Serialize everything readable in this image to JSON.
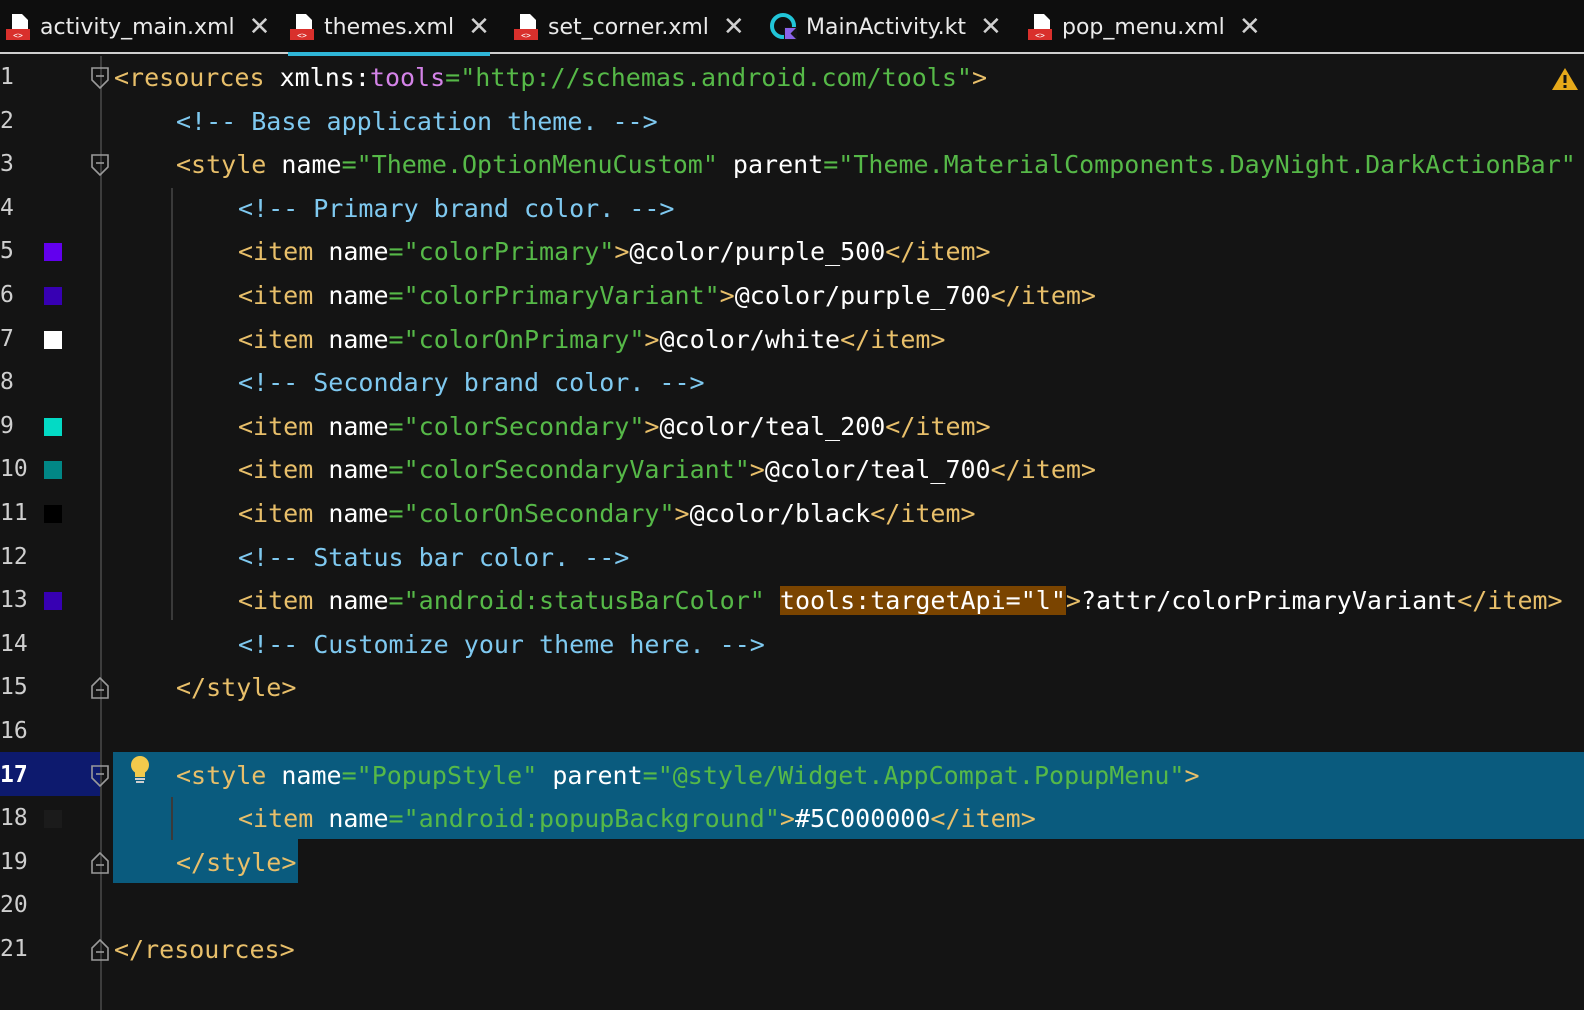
{
  "tabs": [
    {
      "label": "activity_main.xml",
      "icon": "xml-file-icon",
      "active": false
    },
    {
      "label": "themes.xml",
      "icon": "xml-file-icon",
      "active": true
    },
    {
      "label": "set_corner.xml",
      "icon": "xml-file-icon",
      "active": false
    },
    {
      "label": "MainActivity.kt",
      "icon": "kotlin-file-icon",
      "active": false
    },
    {
      "label": "pop_menu.xml",
      "icon": "xml-file-icon",
      "active": false
    }
  ],
  "close_glyph": "✕",
  "colors": {
    "purple_500": "#6200EE",
    "purple_700": "#3700B3",
    "white": "#FFFFFF",
    "teal_200": "#03DAC5",
    "teal_700": "#018786",
    "black": "#000000",
    "popup_bg": "#5C000000",
    "selection": "#0a5b7e",
    "accent": "#2fb6d8"
  },
  "editor": {
    "current_line": 17,
    "lines": [
      {
        "num": "1"
      },
      {
        "num": "2"
      },
      {
        "num": "3"
      },
      {
        "num": "4"
      },
      {
        "num": "5"
      },
      {
        "num": "6"
      },
      {
        "num": "7"
      },
      {
        "num": "8"
      },
      {
        "num": "9"
      },
      {
        "num": "10"
      },
      {
        "num": "11"
      },
      {
        "num": "12"
      },
      {
        "num": "13"
      },
      {
        "num": "14"
      },
      {
        "num": "15"
      },
      {
        "num": "16"
      },
      {
        "num": "17"
      },
      {
        "num": "18"
      },
      {
        "num": "19"
      },
      {
        "num": "20"
      },
      {
        "num": "21"
      }
    ],
    "code": {
      "l1_open": "<resources ",
      "l1_attr": "xmlns:",
      "l1_ns": "tools",
      "l1_eq": "=",
      "l1_val": "\"http://schemas.android.com/tools\"",
      "l1_close": ">",
      "l2": "<!-- Base application theme. -->",
      "l3_open": "<style ",
      "l3_attr1": "name",
      "l3_val1": "\"Theme.OptionMenuCustom\"",
      "l3_attr2": " parent",
      "l3_val2": "\"Theme.MaterialComponents.DayNight.DarkActionBar\"",
      "l4": "<!-- Primary brand color. -->",
      "l5_name": "\"colorPrimary\"",
      "l5_val": "@color/purple_500",
      "l6_name": "\"colorPrimaryVariant\"",
      "l6_val": "@color/purple_700",
      "l7_name": "\"colorOnPrimary\"",
      "l7_val": "@color/white",
      "l8": "<!-- Secondary brand color. -->",
      "l9_name": "\"colorSecondary\"",
      "l9_val": "@color/teal_200",
      "l10_name": "\"colorSecondaryVariant\"",
      "l10_val": "@color/teal_700",
      "l11_name": "\"colorOnSecondary\"",
      "l11_val": "@color/black",
      "l12": "<!-- Status bar color. -->",
      "l13_name": "\"android:statusBarColor\"",
      "l13_tools": "tools:targetApi=\"l\"",
      "l13_val": "?attr/colorPrimaryVariant",
      "l14": "<!-- Customize your theme here. -->",
      "l15": "</style>",
      "l17_name": "\"PopupStyle\"",
      "l17_parent": "\"@style/Widget.AppCompat.PopupMenu\"",
      "l18_name": "\"android:popupBackground\"",
      "l18_val": "#5C000000",
      "l19": "</style>",
      "l21": "</resources>",
      "item_open": "<item ",
      "item_attr": "name",
      "eq": "=",
      "gt": ">",
      "item_close": "</item>",
      "style_open": "<style ",
      "parent_attr": " parent"
    }
  }
}
